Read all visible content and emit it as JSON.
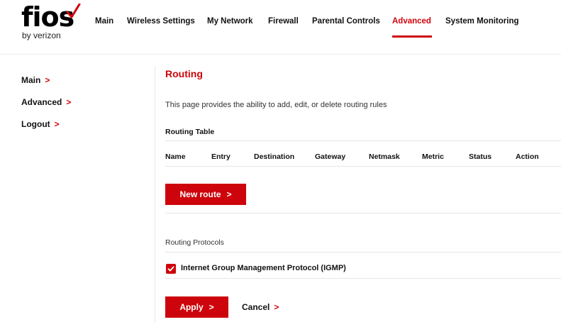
{
  "brand": {
    "name": "fios",
    "tagline": "by verizon",
    "accent": "#cd040b"
  },
  "nav": {
    "items": [
      "Main",
      "Wireless Settings",
      "My Network",
      "Firewall",
      "Parental Controls",
      "Advanced",
      "System Monitoring"
    ],
    "active": "Advanced"
  },
  "sidebar": {
    "items": [
      {
        "label": "Main",
        "icon": "chevron-right-icon"
      },
      {
        "label": "Advanced",
        "icon": "chevron-right-icon"
      },
      {
        "label": "Logout",
        "icon": "chevron-right-icon"
      }
    ]
  },
  "page": {
    "title": "Routing",
    "description": "This page provides the ability to add, edit, or delete routing rules"
  },
  "routing_table": {
    "heading": "Routing Table",
    "columns": [
      "Name",
      "Entry",
      "Destination",
      "Gateway",
      "Netmask",
      "Metric",
      "Status",
      "Action"
    ],
    "rows": []
  },
  "buttons": {
    "new_route": "New route",
    "apply": "Apply",
    "cancel": "Cancel"
  },
  "protocols": {
    "heading": "Routing Protocols",
    "igmp_label": "Internet Group Management Protocol (IGMP)",
    "igmp_checked": true
  }
}
